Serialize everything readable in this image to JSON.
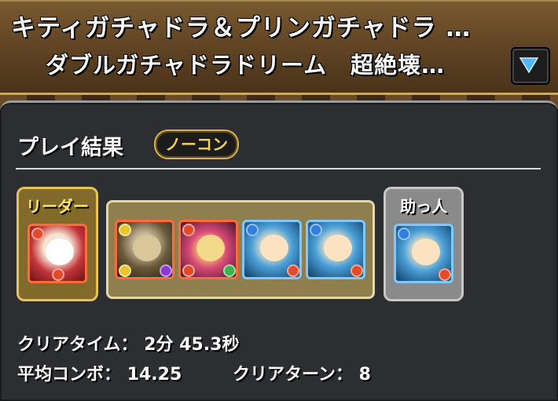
{
  "header": {
    "dungeon_title": "キティガチャドラ＆プリンガチャドラ …",
    "floor_title": "ダブルガチャドラドリーム　超絶壊…"
  },
  "result": {
    "heading": "プレイ結果",
    "badge": "ノーコン",
    "leader_label": "リーダー",
    "helper_label": "助っ人",
    "team": {
      "leader": {
        "attr": "fire",
        "icon": "hello-kitty-dragon-icon"
      },
      "subs": [
        {
          "attr": "dark",
          "icon": "armored-warrior-icon"
        },
        {
          "attr": "fire",
          "icon": "pink-dragon-girl-icon"
        },
        {
          "attr": "water",
          "icon": "blonde-mermaid-icon"
        },
        {
          "attr": "water",
          "icon": "blonde-mermaid-icon"
        }
      ],
      "helper": {
        "attr": "water",
        "icon": "blonde-mermaid-icon"
      }
    },
    "clear_time_label": "クリアタイム：",
    "clear_time_value": "2分 45.3秒",
    "avg_combo_label": "平均コンボ：",
    "avg_combo_value": "14.25",
    "clear_turns_label": "クリアターン：",
    "clear_turns_value": "8"
  },
  "colors": {
    "header_brown": "#5e4222",
    "panel_bg": "#2c2e31",
    "leader_gold": "#e6c35a",
    "badge_gold": "#d8b24a"
  }
}
